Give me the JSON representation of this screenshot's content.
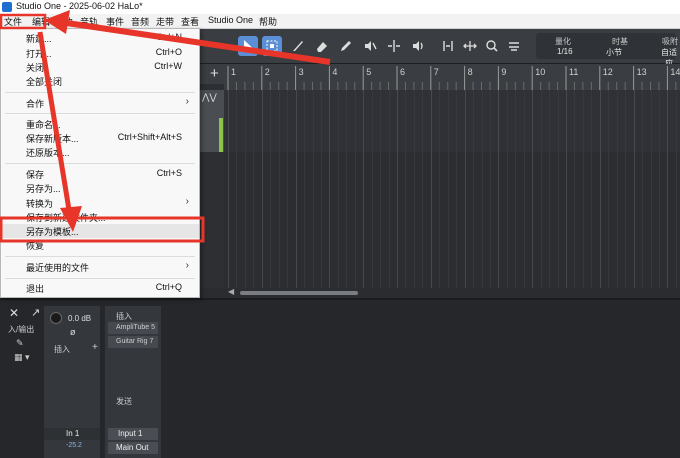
{
  "window": {
    "title": "Studio One - 2025-06-02 HaLo*"
  },
  "menubar": {
    "items": [
      "文件",
      "编辑",
      "曲",
      "音轨",
      "事件",
      "音频",
      "走带",
      "查看",
      "Studio One",
      "帮助"
    ]
  },
  "file_menu": {
    "items": [
      {
        "label": "新建...",
        "shortcut": "Ctrl+N"
      },
      {
        "label": "打开...",
        "shortcut": "Ctrl+O"
      },
      {
        "label": "关闭",
        "shortcut": "Ctrl+W"
      },
      {
        "label": "全部关闭",
        "shortcut": ""
      },
      {
        "label": "合作",
        "shortcut": "",
        "submenu": true
      },
      {
        "label": "重命名...",
        "shortcut": ""
      },
      {
        "label": "保存新版本...",
        "shortcut": "Ctrl+Shift+Alt+S"
      },
      {
        "label": "还原版本...",
        "shortcut": ""
      },
      {
        "label": "保存",
        "shortcut": "Ctrl+S"
      },
      {
        "label": "另存为...",
        "shortcut": ""
      },
      {
        "label": "转换为",
        "shortcut": "",
        "submenu": true
      },
      {
        "label": "保存到新建文件夹...",
        "shortcut": ""
      },
      {
        "label": "另存为模板...",
        "shortcut": "",
        "highlighted": true
      },
      {
        "label": "恢复",
        "shortcut": ""
      },
      {
        "label": "最近使用的文件",
        "shortcut": "",
        "submenu": true
      },
      {
        "label": "退出",
        "shortcut": "Ctrl+Q"
      }
    ]
  },
  "toolbar": {
    "quantize_label": "量化",
    "quantize_value": "1/16",
    "timebase_label": "时基",
    "timebase_value": "小节",
    "snap_label": "吸附",
    "snap_value": "自适应"
  },
  "ruler": {
    "numbers": [
      "1",
      "2",
      "3",
      "4",
      "5",
      "6",
      "7",
      "8",
      "9",
      "10",
      "11",
      "12",
      "13",
      "14"
    ]
  },
  "mixer": {
    "gain_value": "0.0 dB",
    "phase_symbol": "ø",
    "insert_label": "插入",
    "plugins": [
      "AmpliTube 5",
      "Guitar Rig 7"
    ],
    "send_label": "发送",
    "input_left": "In 1",
    "input_left_level": "-25.2",
    "input_right": "Input 1",
    "output_right": "Main Out",
    "io_label": "入/输出"
  },
  "annotation": {
    "color": "#e8352a"
  }
}
